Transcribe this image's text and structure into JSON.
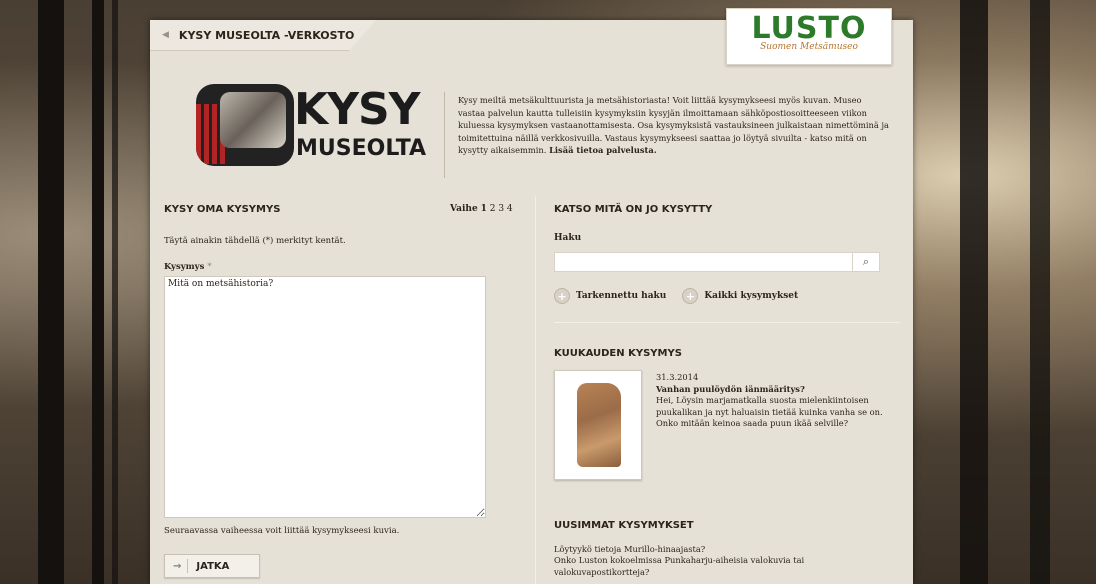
{
  "network_link": {
    "label": "KYSY MUSEOLTA -VERKOSTO"
  },
  "brand": {
    "name": "LUSTO",
    "subtitle": "Suomen Metsämuseo"
  },
  "service_logo": {
    "line1": "KYSY",
    "line2": "MUSEOLTA"
  },
  "intro": {
    "text": "Kysy meiltä metsäkulttuurista ja metsähistoriasta! Voit liittää kysymykseesi myös kuvan. Museo vastaa palvelun kautta tulleisiin kysymyksiin kysyjän ilmoittamaan sähköpostiosoitteeseen viikon kuluessa kysymyksen vastaanottamisesta. Osa kysymyksistä vastauksineen julkaistaan nimettöminä ja toimitettuina näillä verkkosivuilla. Vastaus kysymykseesi saattaa jo löytyä sivuilta - katso mitä on kysytty aikaisemmin.",
    "more_link": "Lisää tietoa palvelusta."
  },
  "ask_form": {
    "title": "KYSY OMA KYSYMYS",
    "steps_label": "Vaihe",
    "steps": [
      "1",
      "2",
      "3",
      "4"
    ],
    "required_note": "Täytä ainakin tähdellä (*) merkityt kentät.",
    "question_label": "Kysymys",
    "required_mark": "*",
    "question_value": "Mitä on metsähistoria?",
    "next_note": "Seuraavassa vaiheessa voit liittää kysymykseesi kuvia.",
    "continue_button": "JATKA"
  },
  "browse": {
    "title": "KATSO MITÄ ON JO KYSYTTY",
    "search_label": "Haku",
    "search_value": "",
    "advanced_link": "Tarkennettu haku",
    "all_link": "Kaikki kysymykset"
  },
  "question_of_month": {
    "title": "KUUKAUDEN KYSYMYS",
    "date": "31.3.2014",
    "question_title": "Vanhan puulöydön iänmääritys?",
    "excerpt": "Hei, Löysin marjamatkalla suosta mielenkiintoisen puukalikan ja nyt haluaisin tietää kuinka vanha se on. Onko mitään keinoa saada puun ikää selville?"
  },
  "latest": {
    "title": "UUSIMMAT KYSYMYKSET",
    "items": [
      "Löytyykö tietoja Murillo-hinaajasta?",
      "Onko Luston kokoelmissa Punkaharju-aiheisia valokuvia tai valokuvapostikortteja?"
    ]
  }
}
